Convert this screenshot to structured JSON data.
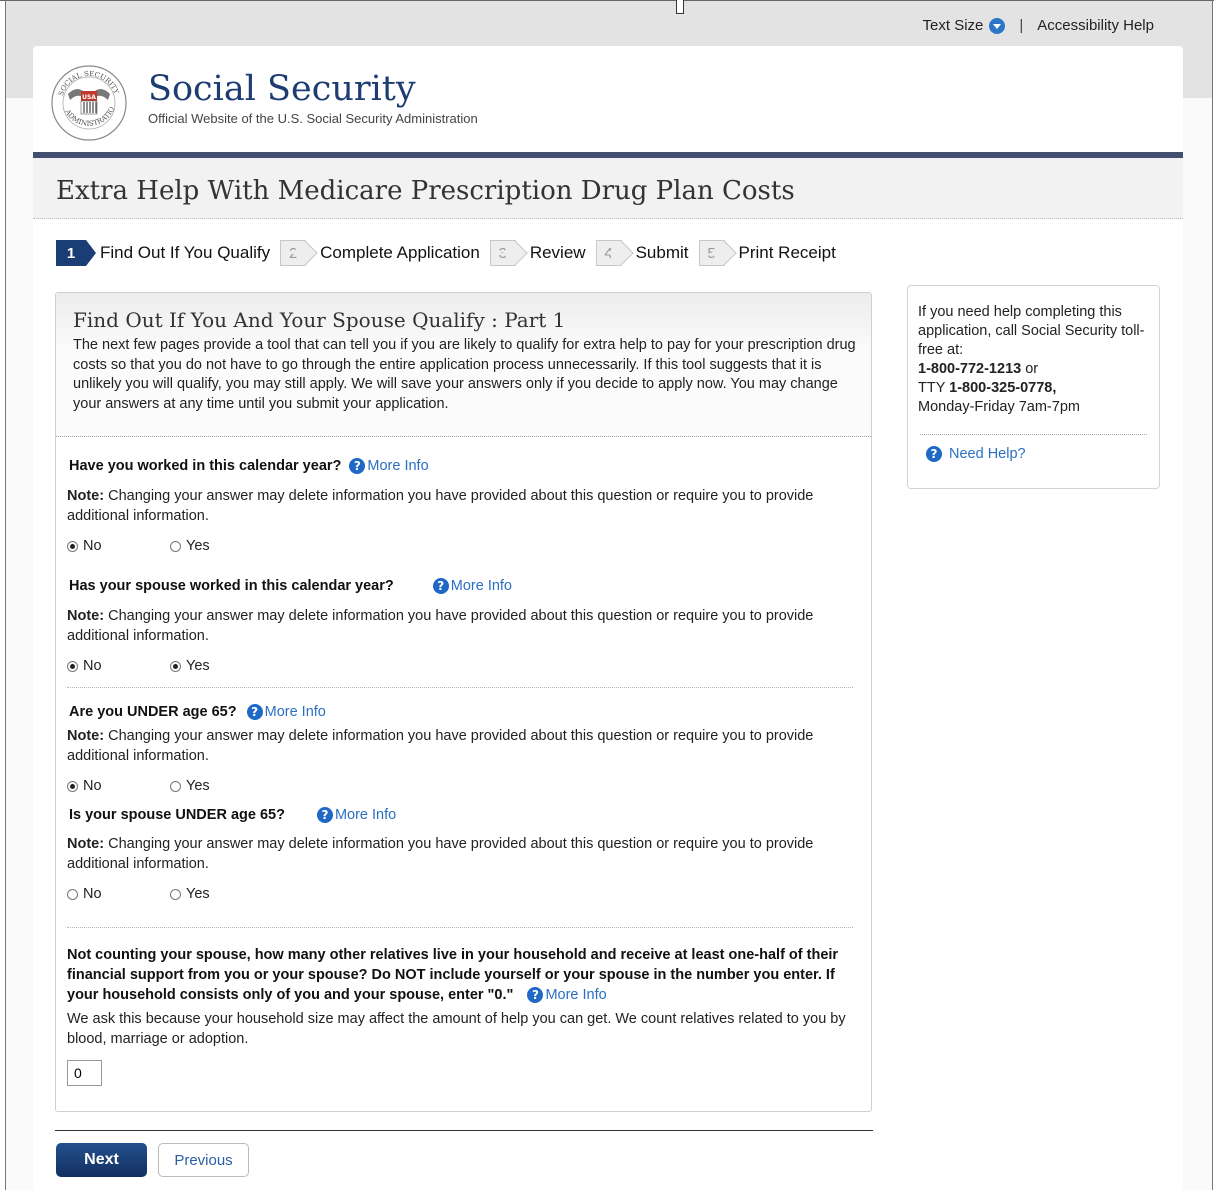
{
  "utility": {
    "text_size": "Text Size",
    "separator": "|",
    "accessibility": "Accessibility Help"
  },
  "brand": {
    "title": "Social Security",
    "subtitle": "Official Website of the U.S. Social Security Administration",
    "seal_text": "SOCIAL SECURITY ADMINISTRATION USA"
  },
  "page_title": "Extra Help With Medicare Prescription Drug Plan Costs",
  "steps": [
    {
      "num": "1",
      "label": "Find Out If You Qualify",
      "active": true
    },
    {
      "num": "2",
      "label": "Complete Application",
      "active": false
    },
    {
      "num": "3",
      "label": "Review",
      "active": false
    },
    {
      "num": "4",
      "label": "Submit",
      "active": false
    },
    {
      "num": "5",
      "label": "Print Receipt",
      "active": false
    }
  ],
  "section": {
    "title": "Find Out If You And Your Spouse Qualify : Part 1",
    "intro": "The next few pages provide a tool that can tell you if you are likely to qualify for extra help to pay for your prescription drug costs so that you do not have to go through the entire application process unnecessarily. If this tool suggests that it is unlikely you will qualify, you may still apply. We will save your answers only if you decide to apply now. You may change your answers at any time until you submit your application."
  },
  "more_info": "More Info",
  "note_label": "Note:",
  "note_text": "Changing your answer may delete information you have provided about this question or require you to provide additional information.",
  "questions": [
    {
      "text": "Have you worked in this calendar year?",
      "no": "No",
      "yes": "Yes",
      "selected": "No"
    },
    {
      "text": "Has your spouse worked in this calendar year?",
      "no": "No",
      "yes": "Yes",
      "selected": "Both"
    },
    {
      "text": "Are you UNDER age 65?",
      "no": "No",
      "yes": "Yes",
      "selected": "No"
    },
    {
      "text": "Is your spouse UNDER age 65?",
      "no": "No",
      "yes": "Yes",
      "selected": "None"
    }
  ],
  "household": {
    "question": "Not counting your spouse, how many other relatives live in your household and receive at least one-half of their financial support from you or your spouse? Do NOT include yourself or your spouse in the number you enter. If your household consists only of you and your spouse, enter \"0.\"",
    "explanation": "We ask this because your household size may affect the amount of help you can get. We count relatives related to you by blood, marriage or adoption.",
    "value": "0"
  },
  "buttons": {
    "next": "Next",
    "previous": "Previous"
  },
  "help": {
    "line1": "If you need help completing this application, call Social Security toll-free at:",
    "phone": "1-800-772-1213",
    "or": " or",
    "tty_label": "TTY ",
    "tty": "1-800-325-0778,",
    "hours": "Monday-Friday 7am-7pm",
    "need_help": "Need Help?"
  }
}
